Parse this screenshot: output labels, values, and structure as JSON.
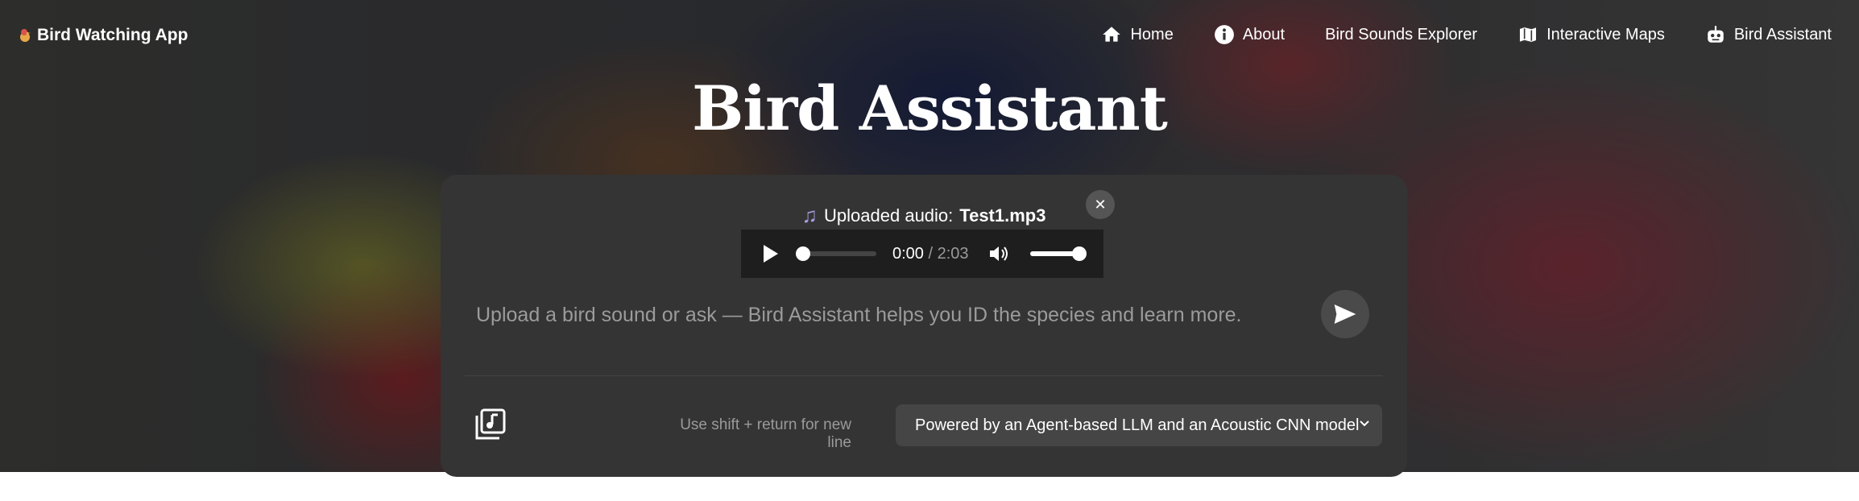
{
  "nav": {
    "brand": "Bird Watching App",
    "items": [
      {
        "label": "Home",
        "icon": "home-icon"
      },
      {
        "label": "About",
        "icon": "info-icon"
      },
      {
        "label": "Bird Sounds Explorer",
        "icon": ""
      },
      {
        "label": "Interactive Maps",
        "icon": "map-icon"
      },
      {
        "label": "Bird Assistant",
        "icon": "robot-icon"
      }
    ]
  },
  "page": {
    "title": "Bird Assistant"
  },
  "chat": {
    "upload_prefix": "Uploaded audio:",
    "upload_file": "Test1.mp3",
    "close_label": "✕",
    "player": {
      "current": "0:00",
      "separator": " / ",
      "duration": "2:03",
      "progress": 0.0,
      "volume": 1.0
    },
    "placeholder": "Upload a bird sound or ask — Bird Assistant helps you ID the species and learn more.",
    "hint": "Use shift + return for new line",
    "model_selected": "Powered by an Agent-based LLM and an Acoustic CNN model"
  },
  "colors": {
    "panel": "#343434",
    "select": "#454545",
    "accent_note": "#a99be0"
  }
}
